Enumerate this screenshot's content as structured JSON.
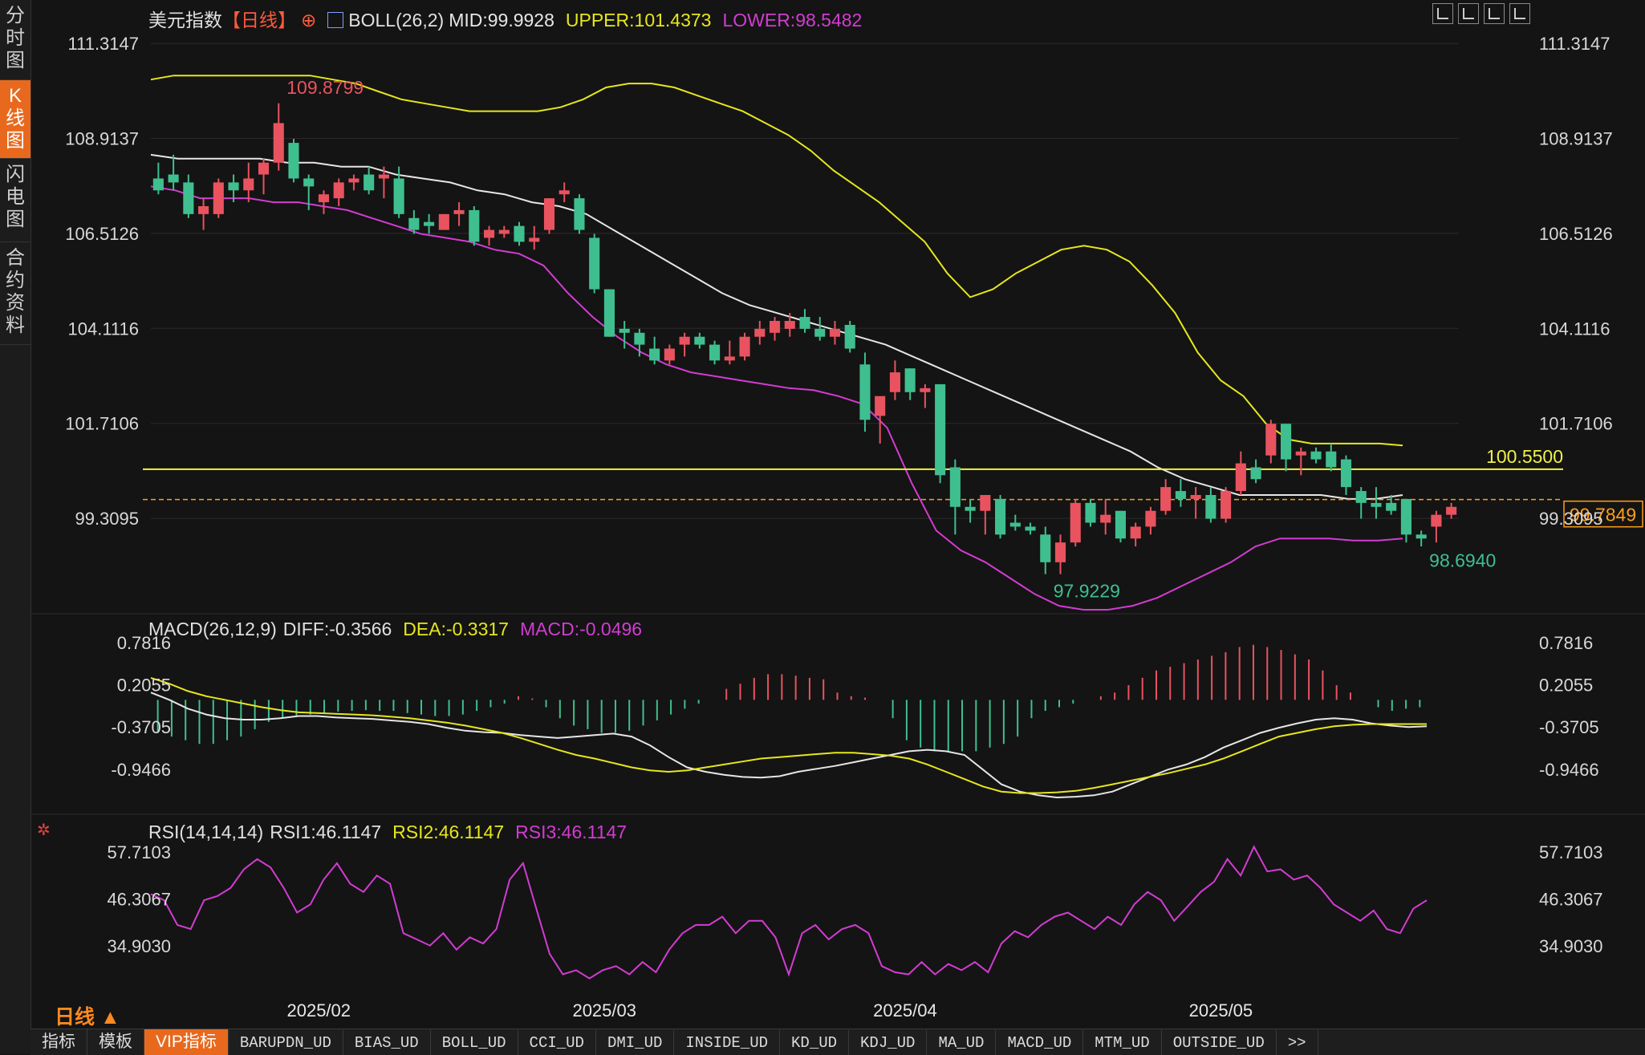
{
  "sidebar": {
    "tabs": [
      {
        "label": "分时图",
        "active": false
      },
      {
        "label": "K线图",
        "active": true
      },
      {
        "label": "闪电图",
        "active": false
      },
      {
        "label": "合约资料",
        "active": false
      }
    ]
  },
  "header": {
    "symbol": "美元指数",
    "period_tag": "【日线】",
    "boll": {
      "label": "BOLL(26,2)",
      "mid": "MID:99.9928",
      "upper": "UPPER:101.4373",
      "lower": "LOWER:98.5482"
    }
  },
  "macd_header": {
    "label": "MACD(26,12,9)",
    "diff": "DIFF:-0.3566",
    "dea": "DEA:-0.3317",
    "macd": "MACD:-0.0496"
  },
  "rsi_header": {
    "label": "RSI(14,14,14)",
    "rsi1": "RSI1:46.1147",
    "rsi2": "RSI2:46.1147",
    "rsi3": "RSI3:46.1147"
  },
  "period_label": "日线 ▲",
  "bottom_tabs": [
    {
      "label": "指标",
      "active": false,
      "mono": false
    },
    {
      "label": "模板",
      "active": false,
      "mono": false
    },
    {
      "label": "VIP指标",
      "active": true,
      "mono": false
    },
    {
      "label": "BARUPDN_UD",
      "active": false,
      "mono": true
    },
    {
      "label": "BIAS_UD",
      "active": false,
      "mono": true
    },
    {
      "label": "BOLL_UD",
      "active": false,
      "mono": true
    },
    {
      "label": "CCI_UD",
      "active": false,
      "mono": true
    },
    {
      "label": "DMI_UD",
      "active": false,
      "mono": true
    },
    {
      "label": "INSIDE_UD",
      "active": false,
      "mono": true
    },
    {
      "label": "KD_UD",
      "active": false,
      "mono": true
    },
    {
      "label": "KDJ_UD",
      "active": false,
      "mono": true
    },
    {
      "label": "MA_UD",
      "active": false,
      "mono": true
    },
    {
      "label": "MACD_UD",
      "active": false,
      "mono": true
    },
    {
      "label": "MTM_UD",
      "active": false,
      "mono": true
    },
    {
      "label": "OUTSIDE_UD",
      "active": false,
      "mono": true
    },
    {
      "label": ">>",
      "active": false,
      "mono": true
    }
  ],
  "colors": {
    "up": "#e8535f",
    "down": "#3fbf8f",
    "upper": "#e6e61e",
    "mid": "#e6e6e6",
    "lower": "#d23cd2",
    "dea": "#e6e61e",
    "rsi": "#d23cd2",
    "hline": "#f0f04a",
    "last": "#ff9f1a"
  },
  "chart_data": {
    "price_panel": {
      "type": "candlestick",
      "y_ticks": [
        "111.3147",
        "108.9137",
        "106.5126",
        "104.1116",
        "101.7106",
        "99.3095"
      ],
      "y_range": [
        97.0,
        111.6
      ],
      "x_ticks": [
        "2025/02",
        "2025/03",
        "2025/04",
        "2025/05"
      ],
      "x_tick_index": [
        8,
        27,
        47,
        68
      ],
      "ohlc": [
        [
          107.9,
          108.3,
          107.5,
          107.6
        ],
        [
          108.0,
          108.5,
          107.6,
          107.8
        ],
        [
          107.8,
          108.0,
          106.9,
          107.0
        ],
        [
          107.0,
          107.4,
          106.6,
          107.2
        ],
        [
          107.0,
          107.9,
          106.9,
          107.8
        ],
        [
          107.8,
          108.0,
          107.3,
          107.6
        ],
        [
          107.6,
          108.3,
          107.3,
          107.9
        ],
        [
          108.0,
          108.4,
          107.5,
          108.3
        ],
        [
          108.3,
          109.8,
          108.1,
          109.3
        ],
        [
          108.8,
          108.9,
          107.8,
          107.9
        ],
        [
          107.9,
          108.0,
          107.1,
          107.7
        ],
        [
          107.3,
          107.6,
          107.0,
          107.5
        ],
        [
          107.4,
          107.9,
          107.2,
          107.8
        ],
        [
          107.8,
          108.0,
          107.6,
          107.9
        ],
        [
          108.0,
          108.2,
          107.5,
          107.6
        ],
        [
          107.9,
          108.2,
          107.4,
          108.0
        ],
        [
          107.9,
          108.2,
          106.9,
          107.0
        ],
        [
          106.9,
          107.1,
          106.5,
          106.6
        ],
        [
          106.8,
          107.0,
          106.5,
          106.7
        ],
        [
          106.6,
          107.0,
          106.6,
          107.0
        ],
        [
          107.0,
          107.3,
          106.7,
          107.1
        ],
        [
          107.1,
          107.2,
          106.2,
          106.3
        ],
        [
          106.4,
          106.7,
          106.2,
          106.6
        ],
        [
          106.5,
          106.7,
          106.4,
          106.6
        ],
        [
          106.7,
          106.8,
          106.2,
          106.3
        ],
        [
          106.3,
          106.7,
          106.1,
          106.4
        ],
        [
          106.6,
          107.4,
          106.5,
          107.4
        ],
        [
          107.5,
          107.8,
          107.3,
          107.6
        ],
        [
          107.4,
          107.5,
          106.5,
          106.6
        ],
        [
          106.4,
          106.5,
          105.0,
          105.1
        ],
        [
          105.1,
          105.1,
          103.9,
          103.9
        ],
        [
          104.1,
          104.3,
          103.6,
          104.0
        ],
        [
          104.0,
          104.1,
          103.4,
          103.7
        ],
        [
          103.6,
          103.9,
          103.2,
          103.3
        ],
        [
          103.3,
          103.7,
          103.2,
          103.6
        ],
        [
          103.7,
          104.0,
          103.4,
          103.9
        ],
        [
          103.9,
          104.0,
          103.6,
          103.7
        ],
        [
          103.7,
          103.8,
          103.2,
          103.3
        ],
        [
          103.3,
          103.8,
          103.2,
          103.4
        ],
        [
          103.4,
          104.0,
          103.3,
          103.9
        ],
        [
          103.9,
          104.3,
          103.7,
          104.1
        ],
        [
          104.0,
          104.4,
          103.8,
          104.3
        ],
        [
          104.1,
          104.5,
          103.9,
          104.3
        ],
        [
          104.4,
          104.6,
          104.0,
          104.1
        ],
        [
          104.1,
          104.4,
          103.8,
          103.9
        ],
        [
          103.9,
          104.3,
          103.7,
          104.1
        ],
        [
          104.2,
          104.3,
          103.5,
          103.6
        ],
        [
          103.2,
          103.5,
          101.5,
          101.8
        ],
        [
          101.9,
          102.2,
          101.2,
          102.4
        ],
        [
          102.5,
          103.3,
          102.3,
          103.0
        ],
        [
          103.1,
          103.1,
          102.3,
          102.5
        ],
        [
          102.5,
          102.7,
          102.1,
          102.6
        ],
        [
          102.7,
          102.7,
          100.2,
          100.4
        ],
        [
          100.6,
          100.8,
          98.9,
          99.6
        ],
        [
          99.6,
          99.8,
          99.2,
          99.5
        ],
        [
          99.5,
          99.9,
          98.9,
          99.9
        ],
        [
          99.8,
          99.9,
          98.8,
          98.9
        ],
        [
          99.2,
          99.4,
          99.0,
          99.1
        ],
        [
          99.1,
          99.2,
          98.9,
          99.0
        ],
        [
          98.9,
          99.1,
          97.9,
          98.2
        ],
        [
          98.2,
          98.9,
          97.9,
          98.7
        ],
        [
          98.7,
          99.8,
          98.6,
          99.7
        ],
        [
          99.7,
          99.8,
          99.1,
          99.2
        ],
        [
          99.2,
          99.8,
          98.9,
          99.4
        ],
        [
          99.5,
          99.5,
          98.7,
          98.8
        ],
        [
          98.8,
          99.2,
          98.6,
          99.1
        ],
        [
          99.1,
          99.6,
          98.9,
          99.5
        ],
        [
          99.5,
          100.3,
          99.4,
          100.1
        ],
        [
          100.0,
          100.3,
          99.6,
          99.8
        ],
        [
          99.8,
          100.1,
          99.3,
          99.9
        ],
        [
          99.9,
          100.1,
          99.2,
          99.3
        ],
        [
          99.3,
          100.1,
          99.2,
          100.0
        ],
        [
          100.0,
          101.0,
          99.9,
          100.7
        ],
        [
          100.6,
          100.8,
          100.2,
          100.3
        ],
        [
          100.9,
          101.8,
          100.7,
          101.7
        ],
        [
          101.7,
          101.7,
          100.5,
          100.8
        ],
        [
          100.9,
          101.1,
          100.4,
          101.0
        ],
        [
          101.0,
          101.1,
          100.7,
          100.8
        ],
        [
          101.0,
          101.2,
          100.5,
          100.6
        ],
        [
          100.8,
          100.9,
          99.9,
          100.1
        ],
        [
          100.0,
          100.1,
          99.3,
          99.7
        ],
        [
          99.7,
          100.1,
          99.3,
          99.6
        ],
        [
          99.7,
          99.9,
          99.4,
          99.5
        ],
        [
          99.8,
          99.8,
          98.7,
          98.9
        ],
        [
          98.9,
          99.0,
          98.6,
          98.8
        ],
        [
          99.1,
          99.5,
          98.7,
          99.4
        ],
        [
          99.4,
          99.7,
          99.3,
          99.6
        ]
      ],
      "boll_upper": [
        110.4,
        110.5,
        110.5,
        110.5,
        110.5,
        110.5,
        110.5,
        110.5,
        110.4,
        110.3,
        110.1,
        109.9,
        109.8,
        109.7,
        109.6,
        109.6,
        109.6,
        109.6,
        109.7,
        109.9,
        110.2,
        110.3,
        110.3,
        110.2,
        110.0,
        109.8,
        109.6,
        109.3,
        109.0,
        108.6,
        108.1,
        107.7,
        107.3,
        106.8,
        106.3,
        105.5,
        104.9,
        105.1,
        105.5,
        105.8,
        106.1,
        106.2,
        106.1,
        105.8,
        105.2,
        104.5,
        103.5,
        102.8,
        102.4,
        101.7,
        101.3,
        101.2,
        101.2,
        101.2,
        101.2,
        101.15
      ],
      "boll_upper_start": 0,
      "boll_mid": [
        108.5,
        108.4,
        108.4,
        108.4,
        108.4,
        108.3,
        108.3,
        108.2,
        108.2,
        108.0,
        107.9,
        107.8,
        107.6,
        107.5,
        107.3,
        107.2,
        107.0,
        106.6,
        106.2,
        105.8,
        105.4,
        105.0,
        104.7,
        104.5,
        104.3,
        104.1,
        103.9,
        103.7,
        103.4,
        103.1,
        102.8,
        102.5,
        102.2,
        101.9,
        101.6,
        101.3,
        101.0,
        100.6,
        100.3,
        100.1,
        99.9,
        99.9,
        99.9,
        99.9,
        99.8,
        99.8,
        99.9
      ],
      "boll_mid_start": 0,
      "boll_lower": [
        107.7,
        107.6,
        107.4,
        107.4,
        107.4,
        107.3,
        107.3,
        107.2,
        107.1,
        106.9,
        106.7,
        106.5,
        106.4,
        106.3,
        106.1,
        106.0,
        105.7,
        105.0,
        104.4,
        103.9,
        103.5,
        103.2,
        103.0,
        102.9,
        102.8,
        102.7,
        102.6,
        102.55,
        102.4,
        102.2,
        101.6,
        100.2,
        99.0,
        98.5,
        98.2,
        97.8,
        97.4,
        97.1,
        97.0,
        97.0,
        97.1,
        97.3,
        97.6,
        97.9,
        98.2,
        98.6,
        98.8,
        98.8,
        98.8,
        98.75,
        98.75,
        98.8
      ],
      "hline_value": 100.55,
      "hline_label": "100.5500",
      "last_price": 99.7849,
      "last_label": "99.7849",
      "annotations": [
        {
          "text": "109.8799",
          "index": 8,
          "value": 109.88,
          "color": "up"
        },
        {
          "text": "97.9229",
          "index": 59,
          "value": 97.92,
          "color": "down"
        },
        {
          "text": "98.6940",
          "index": 84,
          "value": 98.69,
          "color": "down"
        }
      ]
    },
    "macd_panel": {
      "type": "bar+line",
      "y_ticks": [
        "0.7816",
        "0.2055",
        "-0.3705",
        "-0.9466"
      ],
      "y_range": [
        -1.45,
        0.9
      ],
      "hist": [
        -0.45,
        -0.5,
        -0.55,
        -0.6,
        -0.6,
        -0.55,
        -0.5,
        -0.4,
        -0.3,
        -0.25,
        -0.22,
        -0.2,
        -0.18,
        -0.16,
        -0.15,
        -0.14,
        -0.15,
        -0.15,
        -0.18,
        -0.2,
        -0.22,
        -0.22,
        -0.2,
        -0.15,
        -0.1,
        -0.05,
        0.05,
        0.02,
        -0.1,
        -0.25,
        -0.35,
        -0.4,
        -0.45,
        -0.45,
        -0.42,
        -0.35,
        -0.28,
        -0.2,
        -0.12,
        -0.05,
        0.0,
        0.15,
        0.22,
        0.3,
        0.35,
        0.35,
        0.33,
        0.3,
        0.28,
        0.1,
        0.05,
        0.03,
        0.0,
        -0.25,
        -0.55,
        -0.65,
        -0.7,
        -0.7,
        -0.7,
        -0.7,
        -0.65,
        -0.6,
        -0.5,
        -0.25,
        -0.15,
        -0.1,
        -0.05,
        0.0,
        0.05,
        0.1,
        0.2,
        0.3,
        0.4,
        0.45,
        0.5,
        0.55,
        0.6,
        0.65,
        0.72,
        0.75,
        0.72,
        0.68,
        0.62,
        0.55,
        0.4,
        0.2,
        0.1,
        0.0,
        -0.1,
        -0.15,
        -0.12,
        -0.1
      ],
      "diff": [
        0.1,
        0.0,
        -0.12,
        -0.2,
        -0.25,
        -0.27,
        -0.27,
        -0.25,
        -0.22,
        -0.22,
        -0.24,
        -0.25,
        -0.26,
        -0.28,
        -0.3,
        -0.33,
        -0.38,
        -0.42,
        -0.44,
        -0.45,
        -0.48,
        -0.5,
        -0.52,
        -0.5,
        -0.48,
        -0.46,
        -0.5,
        -0.62,
        -0.78,
        -0.92,
        -0.98,
        -1.02,
        -1.05,
        -1.06,
        -1.04,
        -0.98,
        -0.94,
        -0.9,
        -0.85,
        -0.8,
        -0.75,
        -0.7,
        -0.68,
        -0.7,
        -0.75,
        -0.95,
        -1.15,
        -1.25,
        -1.3,
        -1.33,
        -1.32,
        -1.3,
        -1.25,
        -1.15,
        -1.05,
        -0.95,
        -0.88,
        -0.78,
        -0.65,
        -0.55,
        -0.45,
        -0.38,
        -0.32,
        -0.27,
        -0.25,
        -0.27,
        -0.32,
        -0.35,
        -0.37,
        -0.36
      ],
      "dea": [
        0.3,
        0.22,
        0.12,
        0.05,
        0.0,
        -0.05,
        -0.1,
        -0.14,
        -0.17,
        -0.18,
        -0.19,
        -0.2,
        -0.21,
        -0.23,
        -0.25,
        -0.28,
        -0.31,
        -0.35,
        -0.4,
        -0.45,
        -0.52,
        -0.6,
        -0.68,
        -0.75,
        -0.8,
        -0.86,
        -0.92,
        -0.96,
        -0.98,
        -0.96,
        -0.92,
        -0.88,
        -0.84,
        -0.8,
        -0.78,
        -0.76,
        -0.74,
        -0.72,
        -0.72,
        -0.74,
        -0.76,
        -0.8,
        -0.88,
        -0.98,
        -1.08,
        -1.18,
        -1.25,
        -1.27,
        -1.27,
        -1.26,
        -1.24,
        -1.2,
        -1.15,
        -1.1,
        -1.05,
        -1.0,
        -0.94,
        -0.88,
        -0.8,
        -0.7,
        -0.6,
        -0.5,
        -0.45,
        -0.4,
        -0.36,
        -0.34,
        -0.33,
        -0.33,
        -0.33,
        -0.33
      ]
    },
    "rsi_panel": {
      "type": "line",
      "y_ticks": [
        "57.7103",
        "46.3067",
        "34.9030"
      ],
      "y_range": [
        24.0,
        62.0
      ],
      "rsi": [
        47.5,
        46.0,
        40.0,
        39.0,
        46.0,
        47.0,
        49.0,
        53.5,
        56.0,
        54.0,
        49.0,
        43.0,
        45.0,
        51.0,
        55.0,
        50.0,
        48.0,
        52.0,
        50.0,
        38.0,
        36.5,
        35.0,
        38.0,
        34.0,
        37.0,
        35.5,
        39.0,
        51.0,
        55.0,
        44.0,
        33.0,
        28.0,
        29.0,
        27.0,
        29.0,
        30.0,
        28.0,
        31.0,
        28.5,
        34.0,
        38.0,
        40.0,
        40.0,
        42.0,
        38.0,
        41.0,
        41.0,
        37.0,
        28.0,
        38.0,
        40.0,
        36.5,
        39.0,
        40.0,
        38.0,
        30.0,
        28.5,
        28.0,
        31.0,
        28.0,
        30.5,
        29.0,
        31.0,
        28.5,
        35.5,
        38.5,
        37.0,
        40.0,
        42.0,
        43.0,
        41.0,
        39.0,
        42.0,
        40.0,
        45.0,
        48.0,
        46.0,
        41.0,
        44.5,
        48.0,
        50.5,
        56.0,
        52.0,
        59.0,
        53.0,
        53.5,
        51.0,
        52.0,
        49.0,
        45.0,
        43.0,
        41.0,
        43.5,
        39.0,
        38.0,
        44.0,
        46.0
      ]
    }
  }
}
